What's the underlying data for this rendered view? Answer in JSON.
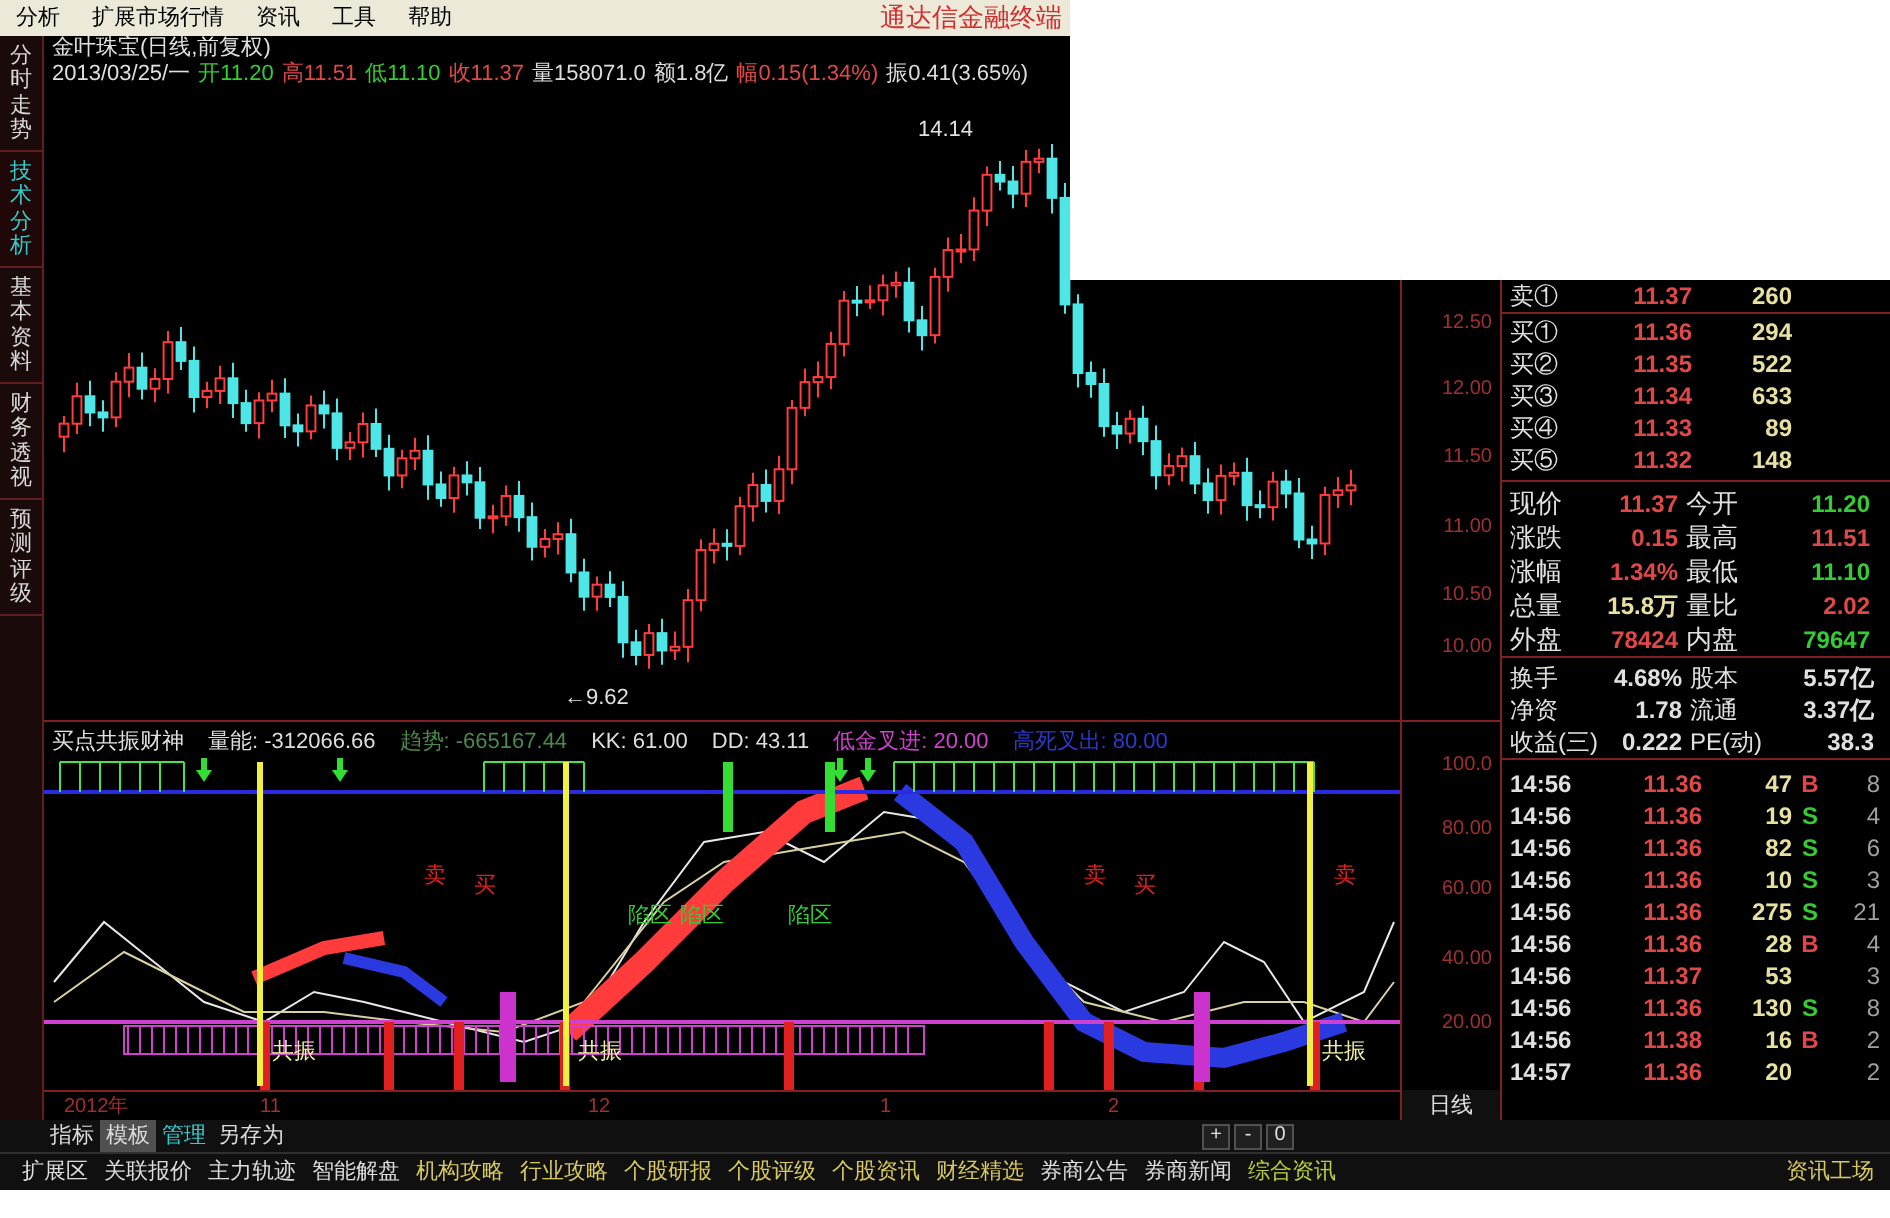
{
  "menu": {
    "items": [
      "分析",
      "扩展市场行情",
      "资讯",
      "工具",
      "帮助"
    ],
    "brand": "通达信金融终端"
  },
  "side_tabs": [
    {
      "label": "分时走势",
      "selected": false
    },
    {
      "label": "技术分析",
      "selected": true
    },
    {
      "label": "基本资料",
      "selected": false
    },
    {
      "label": "财务透视",
      "selected": false
    },
    {
      "label": "预测评级",
      "selected": false
    }
  ],
  "price_chart": {
    "title": "金叶珠宝(日线,前复权)",
    "date": "2013/03/25/一",
    "quote": [
      {
        "label": "开",
        "value": "11.20",
        "color": "#33cc33"
      },
      {
        "label": "高",
        "value": "11.51",
        "color": "#e04848"
      },
      {
        "label": "低",
        "value": "11.10",
        "color": "#33cc33"
      },
      {
        "label": "收",
        "value": "11.37",
        "color": "#e04848"
      },
      {
        "label": "量",
        "value": "158071.0",
        "color": "#dddddd"
      },
      {
        "label": "额",
        "value": "1.8亿",
        "color": "#dddddd"
      },
      {
        "label": "幅",
        "value": "0.15(1.34%)",
        "color": "#e04848"
      },
      {
        "label": "振",
        "value": "0.41(3.65%)",
        "color": "#dddddd"
      }
    ],
    "high_label": "14.14",
    "low_label": "←9.62",
    "axis": [
      "12.50",
      "12.00",
      "11.50",
      "11.00",
      "10.50",
      "10.00"
    ]
  },
  "indicator": {
    "name": "买点共振财神",
    "fields": [
      {
        "text": "量能: -312066.66",
        "color": "#dddddd"
      },
      {
        "text": "趋势: -665167.44",
        "color": "#4a8a4a"
      },
      {
        "text": "KK: 61.00",
        "color": "#dddddd"
      },
      {
        "text": "DD: 43.11",
        "color": "#dddddd"
      },
      {
        "text": "低金叉进: 20.00",
        "color": "#cc44cc"
      },
      {
        "text": "高死叉出: 80.00",
        "color": "#2a3acc"
      }
    ],
    "labels": [
      "卖",
      "买",
      "陷区",
      "陷区",
      "陷区",
      "卖",
      "买",
      "卖",
      "共振",
      "共振",
      "共振"
    ],
    "axis": [
      "100.0",
      "80.00",
      "60.00",
      "40.00",
      "20.00"
    ]
  },
  "date_axis": [
    "2012年",
    "11",
    "12",
    "1",
    "2"
  ],
  "period": "日线",
  "template_tabs": [
    {
      "label": "指标",
      "selected": false,
      "kind": "normal"
    },
    {
      "label": "模板",
      "selected": true,
      "kind": "normal"
    },
    {
      "label": "管理",
      "selected": false,
      "kind": "link"
    },
    {
      "label": "另存为",
      "selected": false,
      "kind": "normal"
    }
  ],
  "zoom_buttons": [
    "+",
    "-",
    "0"
  ],
  "bottom_tabs": [
    {
      "label": "扩展区",
      "kind": "market"
    },
    {
      "label": "关联报价",
      "kind": "market"
    },
    {
      "label": "主力轨迹",
      "kind": "market"
    },
    {
      "label": "智能解盘",
      "kind": "market"
    },
    {
      "label": "机构攻略",
      "kind": "info"
    },
    {
      "label": "行业攻略",
      "kind": "info"
    },
    {
      "label": "个股研报",
      "kind": "info"
    },
    {
      "label": "个股评级",
      "kind": "info"
    },
    {
      "label": "个股资讯",
      "kind": "info"
    },
    {
      "label": "财经精选",
      "kind": "info"
    },
    {
      "label": "券商公告",
      "kind": "market"
    },
    {
      "label": "券商新闻",
      "kind": "market"
    },
    {
      "label": "综合资讯",
      "kind": "general"
    },
    {
      "label": "资讯工场",
      "kind": "info"
    }
  ],
  "order_book": {
    "asks": [
      {
        "label": "卖①",
        "price": "11.37",
        "volume": "260"
      }
    ],
    "bids": [
      {
        "label": "买①",
        "price": "11.36",
        "volume": "294"
      },
      {
        "label": "买②",
        "price": "11.35",
        "volume": "522"
      },
      {
        "label": "买③",
        "price": "11.34",
        "volume": "633"
      },
      {
        "label": "买④",
        "price": "11.33",
        "volume": "89"
      },
      {
        "label": "买⑤",
        "price": "11.32",
        "volume": "148"
      }
    ]
  },
  "quote_stats": [
    {
      "cells": [
        {
          "label": "现价",
          "value": "11.37",
          "color": "#e04848"
        },
        {
          "label": "今开",
          "value": "11.20",
          "color": "#33cc33"
        }
      ]
    },
    {
      "cells": [
        {
          "label": "涨跌",
          "value": "0.15",
          "color": "#e04848"
        },
        {
          "label": "最高",
          "value": "11.51",
          "color": "#e04848"
        }
      ]
    },
    {
      "cells": [
        {
          "label": "涨幅",
          "value": "1.34%",
          "color": "#e04848"
        },
        {
          "label": "最低",
          "value": "11.10",
          "color": "#33cc33"
        }
      ]
    },
    {
      "cells": [
        {
          "label": "总量",
          "value": "15.8万",
          "color": "#e8e0a0"
        },
        {
          "label": "量比",
          "value": "2.02",
          "color": "#e04848"
        }
      ]
    },
    {
      "cells": [
        {
          "label": "外盘",
          "value": "78424",
          "color": "#e04848"
        },
        {
          "label": "内盘",
          "value": "79647",
          "color": "#33cc33"
        }
      ]
    }
  ],
  "fundamentals": [
    {
      "label": "换手",
      "value": "4.68%",
      "label2": "股本",
      "value2": "5.57亿"
    },
    {
      "label": "净资",
      "value": "1.78",
      "label2": "流通",
      "value2": "3.37亿"
    },
    {
      "label": "收益(三)",
      "value": "0.222",
      "label2": "PE(动)",
      "value2": "38.3"
    }
  ],
  "trades": [
    {
      "time": "14:56",
      "price": "11.36",
      "volume": "47",
      "side": "B",
      "count": "8"
    },
    {
      "time": "14:56",
      "price": "11.36",
      "volume": "19",
      "side": "S",
      "count": "4"
    },
    {
      "time": "14:56",
      "price": "11.36",
      "volume": "82",
      "side": "S",
      "count": "6"
    },
    {
      "time": "14:56",
      "price": "11.36",
      "volume": "10",
      "side": "S",
      "count": "3"
    },
    {
      "time": "14:56",
      "price": "11.36",
      "volume": "275",
      "side": "S",
      "count": "21"
    },
    {
      "time": "14:56",
      "price": "11.36",
      "volume": "28",
      "side": "B",
      "count": "4"
    },
    {
      "time": "14:56",
      "price": "11.37",
      "volume": "53",
      "count": "3"
    },
    {
      "time": "14:56",
      "price": "11.36",
      "volume": "130",
      "side": "S",
      "count": "8"
    },
    {
      "time": "14:56",
      "price": "11.38",
      "volume": "16",
      "side": "B",
      "count": "2"
    },
    {
      "time": "14:57",
      "price": "11.36",
      "volume": "20",
      "count": "2"
    }
  ]
}
